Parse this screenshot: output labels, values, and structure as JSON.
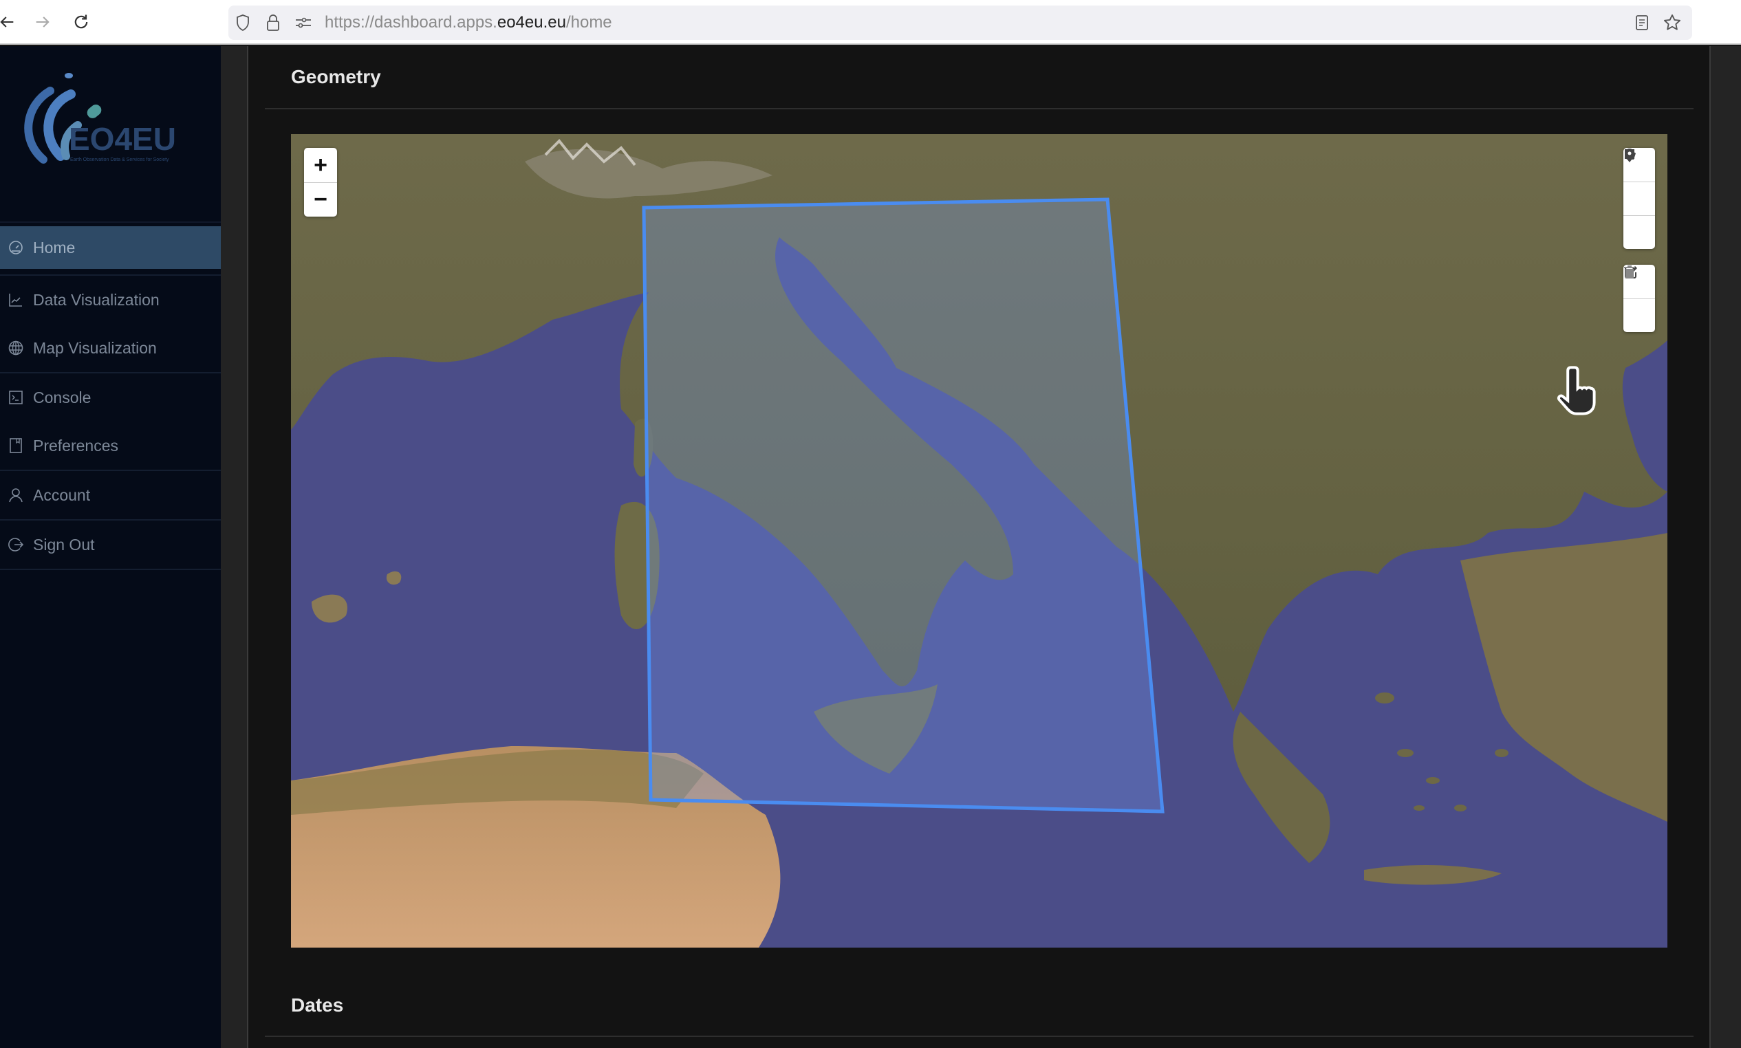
{
  "browser": {
    "url_prefix": "https://dashboard.apps.",
    "url_host": "eo4eu.eu",
    "url_path": "/home",
    "icons": [
      "back-arrow-icon",
      "forward-arrow-icon",
      "reload-icon",
      "shield-icon",
      "lock-icon",
      "permissions-icon",
      "reader-view-icon",
      "bookmark-star-icon"
    ]
  },
  "sidebar": {
    "logo_text": "EO4EU",
    "logo_tagline": "Earth Observation Data & Services for Society",
    "items": [
      {
        "label": "Home",
        "icon": "dashboard-gauge-icon",
        "active": true
      },
      {
        "label": "Data Visualization",
        "icon": "line-chart-icon",
        "active": false
      },
      {
        "label": "Map Visualization",
        "icon": "globe-icon",
        "active": false
      },
      {
        "label": "Console",
        "icon": "terminal-icon",
        "active": false
      },
      {
        "label": "Preferences",
        "icon": "bookmark-doc-icon",
        "active": false
      },
      {
        "label": "Account",
        "icon": "user-icon",
        "active": false
      },
      {
        "label": "Sign Out",
        "icon": "sign-out-icon",
        "active": false
      }
    ]
  },
  "main": {
    "geometry_title": "Geometry",
    "dates_title": "Dates",
    "map": {
      "zoom_in_label": "+",
      "zoom_out_label": "−",
      "draw_tools": [
        "draw-polygon",
        "draw-rectangle",
        "draw-marker"
      ],
      "edit_tools": [
        "edit-layers",
        "delete-layers"
      ],
      "selection_color": "#4a8cf0",
      "region_shown": "Central Mediterranean — Italy, Adriatic, Balkans, Greece, Tunisia"
    }
  },
  "colors": {
    "sidebar_bg": "#050b18",
    "sidebar_active": "#2e4a66",
    "content_bg": "#131313",
    "accent": "#4a8cf0"
  }
}
